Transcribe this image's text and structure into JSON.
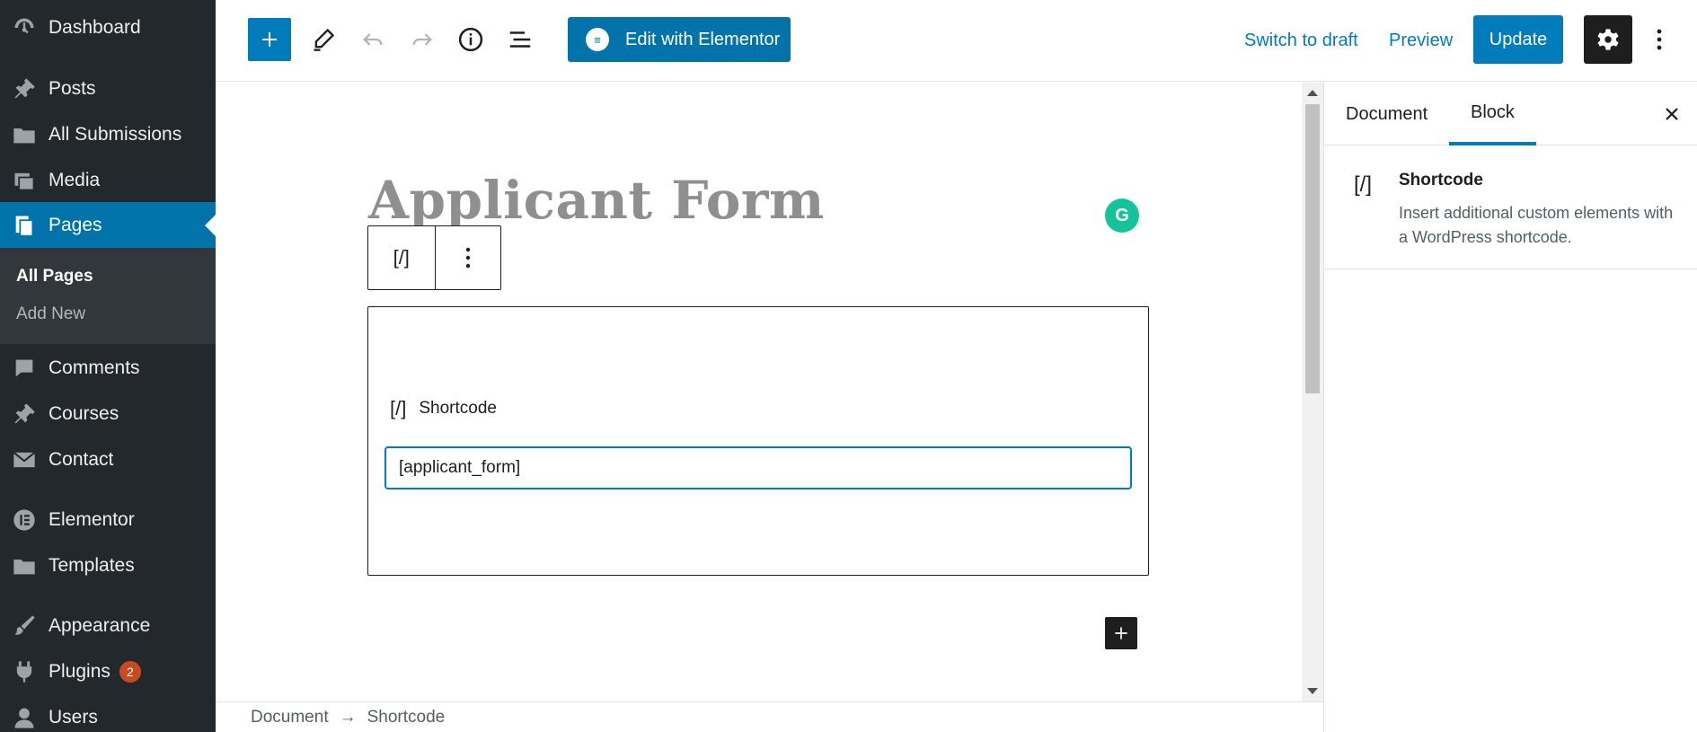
{
  "admin_menu": {
    "items": [
      {
        "label": "Dashboard",
        "icon": "dashboard-icon"
      },
      {
        "label": "Posts",
        "icon": "pin-icon"
      },
      {
        "label": "All Submissions",
        "icon": "folder-icon"
      },
      {
        "label": "Media",
        "icon": "media-icon"
      },
      {
        "label": "Pages",
        "icon": "pages-icon"
      },
      {
        "label": "Comments",
        "icon": "comment-icon"
      },
      {
        "label": "Courses",
        "icon": "pin-icon"
      },
      {
        "label": "Contact",
        "icon": "mail-icon"
      },
      {
        "label": "Elementor",
        "icon": "elementor-icon"
      },
      {
        "label": "Templates",
        "icon": "folder-icon"
      },
      {
        "label": "Appearance",
        "icon": "brush-icon"
      },
      {
        "label": "Plugins",
        "icon": "plugin-icon",
        "badge": "2"
      },
      {
        "label": "Users",
        "icon": "user-icon"
      }
    ],
    "submenu": [
      {
        "label": "All Pages"
      },
      {
        "label": "Add New"
      }
    ]
  },
  "toolbar": {
    "elementor_label": "Edit with Elementor",
    "switch_to_draft": "Switch to draft",
    "preview": "Preview",
    "update": "Update"
  },
  "editor": {
    "title": "Applicant Form",
    "grammarly_letter": "G",
    "block_icon": "[/]",
    "shortcode_label": "Shortcode",
    "shortcode_value": "[applicant_form]"
  },
  "footer": {
    "breadcrumb": [
      "Document",
      "→",
      "Shortcode"
    ]
  },
  "sidebar": {
    "tabs": [
      "Document",
      "Block"
    ],
    "active_tab": "Block",
    "block_icon": "[/]",
    "block_title": "Shortcode",
    "block_description": "Insert additional custom elements with a WordPress shortcode."
  },
  "colors": {
    "admin_bg": "#23282d",
    "admin_active": "#0073aa",
    "accent": "#007cba",
    "badge": "#ca4a1f",
    "grammarly": "#15c39a"
  }
}
